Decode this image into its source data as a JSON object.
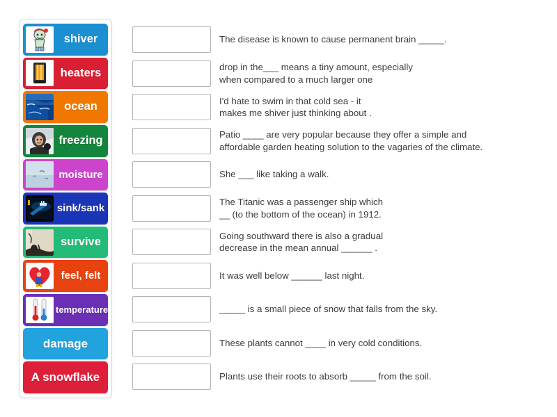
{
  "tiles": [
    {
      "label": "shiver",
      "color": "#1a8fd1",
      "icon": "shivering-person-icon",
      "size": "sz-lg",
      "has_thumb": true
    },
    {
      "label": "heaters",
      "color": "#d91f33",
      "icon": "patio-heater-icon",
      "size": "sz-lg",
      "has_thumb": true
    },
    {
      "label": "ocean",
      "color": "#f07800",
      "icon": "ocean-waves-icon",
      "size": "sz-lg",
      "has_thumb": true
    },
    {
      "label": "freezing",
      "color": "#14853c",
      "icon": "person-in-snow-icon",
      "size": "sz-lg",
      "has_thumb": true
    },
    {
      "label": "moisture",
      "color": "#cc44cc",
      "icon": "misty-sky-icon",
      "size": "sz-md",
      "has_thumb": true
    },
    {
      "label": "sink/sank",
      "color": "#1a35b5",
      "icon": "sinking-ship-icon",
      "size": "sz-md",
      "has_thumb": true
    },
    {
      "label": "survive",
      "color": "#22bb77",
      "icon": "survival-scene-icon",
      "size": "sz-lg",
      "has_thumb": true
    },
    {
      "label": "feel, felt",
      "color": "#e8420e",
      "icon": "heart-hug-icon",
      "size": "sz-md",
      "has_thumb": true
    },
    {
      "label": "temperature",
      "color": "#6b2fb5",
      "icon": "thermometers-icon",
      "size": "sz-sm",
      "has_thumb": true
    },
    {
      "label": "damage",
      "color": "#22a3dd",
      "icon": "none",
      "size": "sz-lg",
      "has_thumb": false
    },
    {
      "label": "A snowflake",
      "color": "#dd1f3a",
      "icon": "none",
      "size": "sz-lg",
      "has_thumb": false
    }
  ],
  "rows": [
    {
      "text": "The disease is known to cause permanent brain _____."
    },
    {
      "text": "drop in the___ means a tiny amount, especially\nwhen compared to a much larger one"
    },
    {
      "text": "I'd hate to swim in that cold sea - it\nmakes me shiver just thinking about ."
    },
    {
      "text": "Patio ____ are very popular because they offer a simple and\naffordable garden heating solution to the vagaries of the climate."
    },
    {
      "text": "She ___ like taking a walk."
    },
    {
      "text": "The Titanic was a passenger ship which\n__ (to the bottom of the ocean) in 1912."
    },
    {
      "text": "Going southward there is also a gradual\ndecrease in the mean annual ______ ."
    },
    {
      "text": "It was well below ______ last night."
    },
    {
      "text": "_____ is a small piece of snow that falls from the sky."
    },
    {
      "text": "These plants cannot ____ in very cold conditions."
    },
    {
      "text": "Plants use their roots to absorb _____ from the soil."
    }
  ]
}
